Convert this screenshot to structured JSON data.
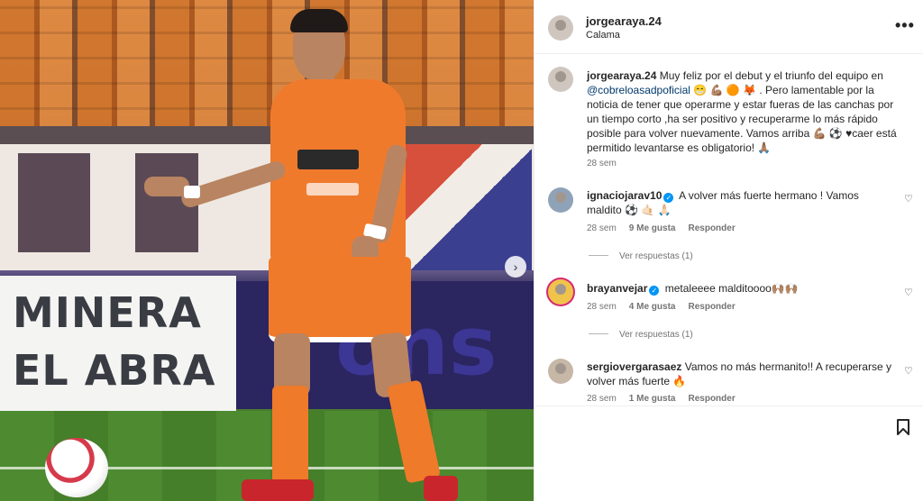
{
  "post": {
    "author": "jorgearaya.24",
    "location": "Calama"
  },
  "caption": {
    "username": "jorgearaya.24",
    "text_part1": " Muy feliz por el debut y el triunfo del equipo en ",
    "mention": "@cobreloasadpoficial",
    "text_part2": " 😁 💪🏽 🟠 🦊 . Pero lamentable por la noticia de tener que operarme y estar fueras de las canchas por un tiempo corto ,ha ser positivo y recuperarme lo más rápido posible para volver nuevamente. Vamos arriba 💪🏽 ⚽ ♥caer está permitido levantarse es obligatorio! 🙏🏽",
    "time": "28 sem"
  },
  "comments": [
    {
      "username": "ignaciojarav10",
      "verified": true,
      "text": "A volver más fuerte hermano ! Vamos maldito ⚽ 🤙🏻 🙏🏻",
      "time": "28 sem",
      "likes": "9 Me gusta",
      "reply": "Responder",
      "view_replies": "Ver respuestas (1)"
    },
    {
      "username": "brayanvejar",
      "verified": true,
      "text": "metaleeee malditoooo🙌🏽🙌🏽",
      "time": "28 sem",
      "likes": "4 Me gusta",
      "reply": "Responder",
      "view_replies": "Ver respuestas (1)"
    },
    {
      "username": "sergiovergarasaez",
      "verified": false,
      "text": "Vamos no más hermanito!! A recuperarse y volver más fuerte 🔥",
      "time": "28 sem",
      "likes": "1 Me gusta",
      "reply": "Responder"
    }
  ],
  "photo": {
    "ad_left_line1": "MINERA",
    "ad_left_line2": "EL ABRA",
    "ad_right_text": "ons",
    "next_icon": "›"
  },
  "icons": {
    "more": "more-options-icon",
    "heart": "heart-icon",
    "bookmark": "bookmark-icon"
  },
  "glyphs": {
    "more": "•••",
    "heart": "♡",
    "verified": "✓"
  }
}
